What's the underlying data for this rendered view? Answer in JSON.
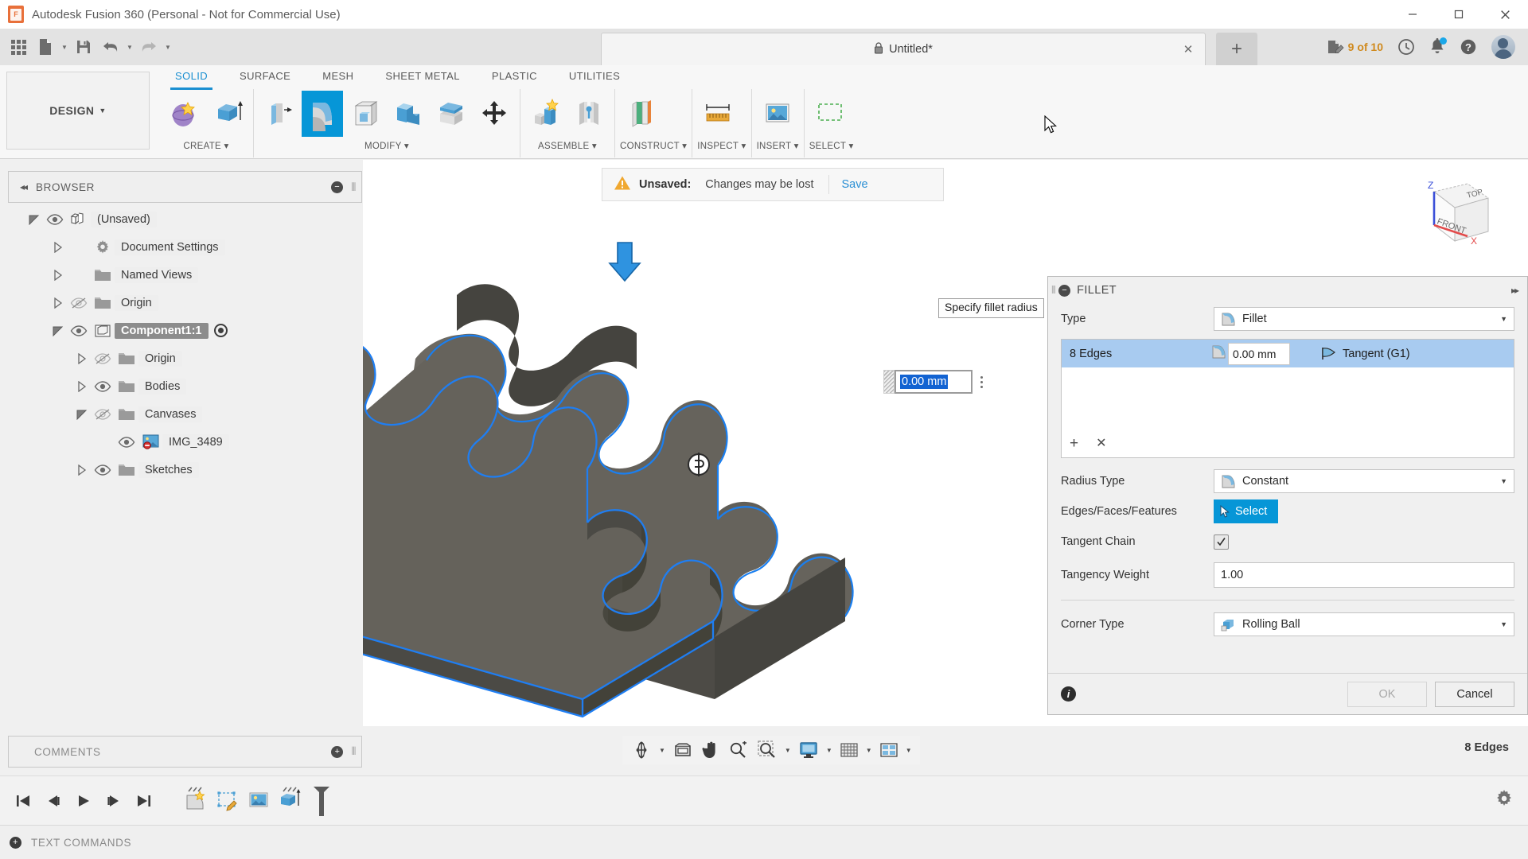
{
  "window": {
    "title": "Autodesk Fusion 360 (Personal - Not for Commercial Use)",
    "logo_letter": "F",
    "minimize": "—",
    "maximize": "❐",
    "close": "✕"
  },
  "quick_access": {
    "grid_label": "app-grid",
    "new_label": "new-document",
    "save_label": "save",
    "undo_label": "undo",
    "redo_label": "redo",
    "caret": "▼"
  },
  "tab_bar": {
    "document_name": "Untitled*",
    "lock_icon": "🔒",
    "close_tab": "✕",
    "new_tab": "+",
    "jobs_text": "9 of 10",
    "jobs_color": "#d08a1e"
  },
  "ribbon": {
    "workspace": "DESIGN",
    "workspace_caret": "▼",
    "tabs": [
      {
        "label": "SOLID",
        "active": true
      },
      {
        "label": "SURFACE",
        "active": false
      },
      {
        "label": "MESH",
        "active": false
      },
      {
        "label": "SHEET METAL",
        "active": false
      },
      {
        "label": "PLASTIC",
        "active": false
      },
      {
        "label": "UTILITIES",
        "active": false
      }
    ],
    "groups": [
      {
        "label": "CREATE ▾"
      },
      {
        "label": "MODIFY ▾"
      },
      {
        "label": "ASSEMBLE ▾"
      },
      {
        "label": "CONSTRUCT ▾"
      },
      {
        "label": "INSPECT ▾"
      },
      {
        "label": "INSERT ▾"
      },
      {
        "label": "SELECT ▾"
      }
    ]
  },
  "browser": {
    "title": "BROWSER",
    "collapse_icon": "◂◂",
    "minimize_icon": "−",
    "tree": [
      {
        "label": "(Unsaved)",
        "indent": 0,
        "arrow": "open",
        "eye": "visible",
        "icon": "component",
        "selected": false
      },
      {
        "label": "Document Settings",
        "indent": 1,
        "arrow": "closed",
        "eye": "none",
        "icon": "gear",
        "selected": false
      },
      {
        "label": "Named Views",
        "indent": 1,
        "arrow": "closed",
        "eye": "none",
        "icon": "folder",
        "selected": false
      },
      {
        "label": "Origin",
        "indent": 1,
        "arrow": "closed",
        "eye": "hidden",
        "icon": "folder",
        "selected": false
      },
      {
        "label": "Component1:1",
        "indent": 1,
        "arrow": "open",
        "eye": "visible",
        "icon": "body",
        "selected": true,
        "activated": true
      },
      {
        "label": "Origin",
        "indent": 2,
        "arrow": "closed",
        "eye": "hidden",
        "icon": "folder",
        "selected": false
      },
      {
        "label": "Bodies",
        "indent": 2,
        "arrow": "closed",
        "eye": "visible",
        "icon": "folder",
        "selected": false
      },
      {
        "label": "Canvases",
        "indent": 2,
        "arrow": "open",
        "eye": "hidden",
        "icon": "folder",
        "selected": false
      },
      {
        "label": "IMG_3489",
        "indent": 3,
        "arrow": "none",
        "eye": "visible",
        "icon": "canvas",
        "selected": false
      },
      {
        "label": "Sketches",
        "indent": 2,
        "arrow": "closed",
        "eye": "visible",
        "icon": "folder",
        "selected": false
      }
    ]
  },
  "comments": {
    "title": "COMMENTS",
    "add_icon": "+"
  },
  "canvas": {
    "notification": {
      "label": "Unsaved:",
      "message": "Changes may be lost",
      "action": "Save",
      "warn_color": "#f0a830"
    },
    "manipulator_value": "0.00 mm",
    "tooltip": "Specify fillet radius",
    "viewcube": {
      "top": "TOP",
      "front": "FRONT",
      "z": "Z",
      "x": "X"
    }
  },
  "fillet_dialog": {
    "title": "FILLET",
    "minimize_icon": "−",
    "expand_icon": "▸▸",
    "type_label": "Type",
    "type_value": "Fillet",
    "edges": [
      {
        "name": "8 Edges",
        "radius": "0.00 mm",
        "continuity": "Tangent (G1)"
      }
    ],
    "add_icon": "+",
    "remove_icon": "✕",
    "radius_type_label": "Radius Type",
    "radius_type_value": "Constant",
    "selection_label": "Edges/Faces/Features",
    "select_button": "Select",
    "tangent_chain_label": "Tangent Chain",
    "tangent_chain_checked": true,
    "tangency_weight_label": "Tangency Weight",
    "tangency_weight_value": "1.00",
    "corner_type_label": "Corner Type",
    "corner_type_value": "Rolling Ball",
    "ok_label": "OK",
    "cancel_label": "Cancel",
    "ok_enabled": false
  },
  "navbar": {
    "items": [
      {
        "name": "orbit",
        "caret": true
      },
      {
        "name": "look-at",
        "caret": false
      },
      {
        "name": "pan",
        "caret": false
      },
      {
        "name": "zoom",
        "caret": false
      },
      {
        "name": "zoom-window",
        "caret": true
      },
      {
        "name": "display-settings",
        "caret": true
      },
      {
        "name": "grid-snaps",
        "caret": true
      },
      {
        "name": "viewports",
        "caret": true
      }
    ]
  },
  "status_bar": {
    "selection": "8 Edges"
  },
  "timeline": {
    "playback": [
      "jump-start",
      "step-back",
      "play",
      "step-forward",
      "jump-end"
    ],
    "features": [
      "sketch-extrude",
      "canvas-edit",
      "canvas-insert",
      "extrude"
    ],
    "settings_icon": "gear"
  },
  "text_commands": {
    "label": "TEXT COMMANDS",
    "add_icon": "+"
  }
}
